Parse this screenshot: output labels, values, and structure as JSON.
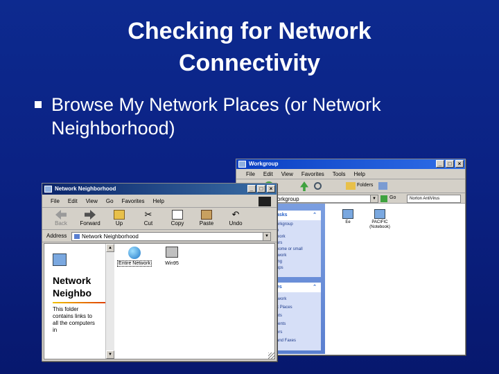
{
  "slide": {
    "title_line1": "Checking for Network",
    "title_line2": "Connectivity",
    "bullet": "Browse My Network Places (or Network Neighborhood)"
  },
  "back_window": {
    "title": "Workgroup",
    "menu": [
      "File",
      "Edit",
      "View",
      "Favorites",
      "Tools",
      "Help"
    ],
    "address_value": "orkgroup",
    "go_label": "Go",
    "links_label": "Norton AntiVirus",
    "folders_label": "Folders",
    "task_header_1": "asks",
    "task_items_1": [
      "orkgroup",
      "e",
      "work",
      "ors",
      "home or small",
      "twork",
      "ing",
      "ups"
    ],
    "task_header_2": "es",
    "task_items_2": [
      "twork",
      "k Places",
      "nts",
      "rents",
      "ers",
      "and Faxes"
    ],
    "items": [
      {
        "label": "Ee",
        "sub": ""
      },
      {
        "label": "PACIFIC",
        "sub": "(Notebook)"
      }
    ],
    "colors": {
      "accent": "#6b8fd6"
    }
  },
  "front_window": {
    "title": "Network Neighborhood",
    "menu": [
      "File",
      "Edit",
      "View",
      "Go",
      "Favorites",
      "Help"
    ],
    "toolbar": [
      {
        "label": "Back",
        "icon": "back-arrow-icon"
      },
      {
        "label": "Forward",
        "icon": "forward-arrow-icon"
      },
      {
        "label": "Up",
        "icon": "up-folder-icon"
      },
      {
        "label": "Cut",
        "icon": "scissors-icon"
      },
      {
        "label": "Copy",
        "icon": "copy-icon"
      },
      {
        "label": "Paste",
        "icon": "paste-icon"
      },
      {
        "label": "Undo",
        "icon": "undo-icon"
      }
    ],
    "address_label": "Address",
    "address_value": "Network Neighborhood",
    "side_heading": "Network Neighbo",
    "side_text": "This folder contains links to all the computers in",
    "items": [
      {
        "label": "Entire Network",
        "icon": "globe-icon"
      },
      {
        "label": "Win95",
        "icon": "computer-icon"
      }
    ]
  }
}
